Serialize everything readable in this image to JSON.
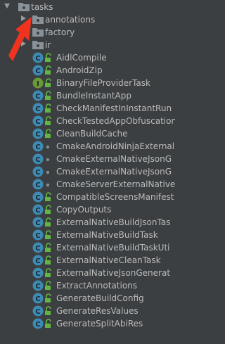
{
  "tree": {
    "root": {
      "label": "tasks",
      "expanded": true
    },
    "packages": [
      {
        "label": "annotations",
        "expanded": false
      },
      {
        "label": "factory",
        "expanded": false
      },
      {
        "label": "ir",
        "expanded": false
      }
    ],
    "classes": [
      {
        "label": "AidlCompile",
        "kind": "class",
        "access": "unlock"
      },
      {
        "label": "AndroidZip",
        "kind": "class",
        "access": "unlock"
      },
      {
        "label": "BinaryFileProviderTask",
        "kind": "interface",
        "access": "unlock"
      },
      {
        "label": "BundleInstantApp",
        "kind": "class",
        "access": "unlock"
      },
      {
        "label": "CheckManifestInInstantRun",
        "kind": "class",
        "access": "unlock"
      },
      {
        "label": "CheckTestedAppObfuscation",
        "kind": "class",
        "access": "unlock"
      },
      {
        "label": "CleanBuildCache",
        "kind": "class",
        "access": "unlock"
      },
      {
        "label": "CmakeAndroidNinjaExternal",
        "kind": "class",
        "access": "dot"
      },
      {
        "label": "CmakeExternalNativeJsonG",
        "kind": "class",
        "access": "dot"
      },
      {
        "label": "CmakeExternalNativeJsonG",
        "kind": "class",
        "access": "dot"
      },
      {
        "label": "CmakeServerExternalNative",
        "kind": "class",
        "access": "dot"
      },
      {
        "label": "CompatibleScreensManifest",
        "kind": "class",
        "access": "unlock"
      },
      {
        "label": "CopyOutputs",
        "kind": "class",
        "access": "unlock"
      },
      {
        "label": "ExternalNativeBuildJsonTas",
        "kind": "class",
        "access": "unlock"
      },
      {
        "label": "ExternalNativeBuildTask",
        "kind": "class",
        "access": "unlock"
      },
      {
        "label": "ExternalNativeBuildTaskUti",
        "kind": "class",
        "access": "unlock"
      },
      {
        "label": "ExternalNativeCleanTask",
        "kind": "class",
        "access": "unlock"
      },
      {
        "label": "ExternalNativeJsonGenerat",
        "kind": "class",
        "access": "unlock"
      },
      {
        "label": "ExtractAnnotations",
        "kind": "class",
        "access": "unlock"
      },
      {
        "label": "GenerateBuildConfig",
        "kind": "class",
        "access": "unlock"
      },
      {
        "label": "GenerateResValues",
        "kind": "class",
        "access": "unlock"
      },
      {
        "label": "GenerateSplitAbiRes",
        "kind": "class",
        "access": "unlock"
      }
    ]
  },
  "colors": {
    "background": "#3c3f41",
    "text": "#bbbbbb",
    "class_icon": "#3d8bb4",
    "interface_icon": "#6a9a38",
    "access_icon": "#62b543",
    "annotation_arrow": "#f0331f"
  }
}
